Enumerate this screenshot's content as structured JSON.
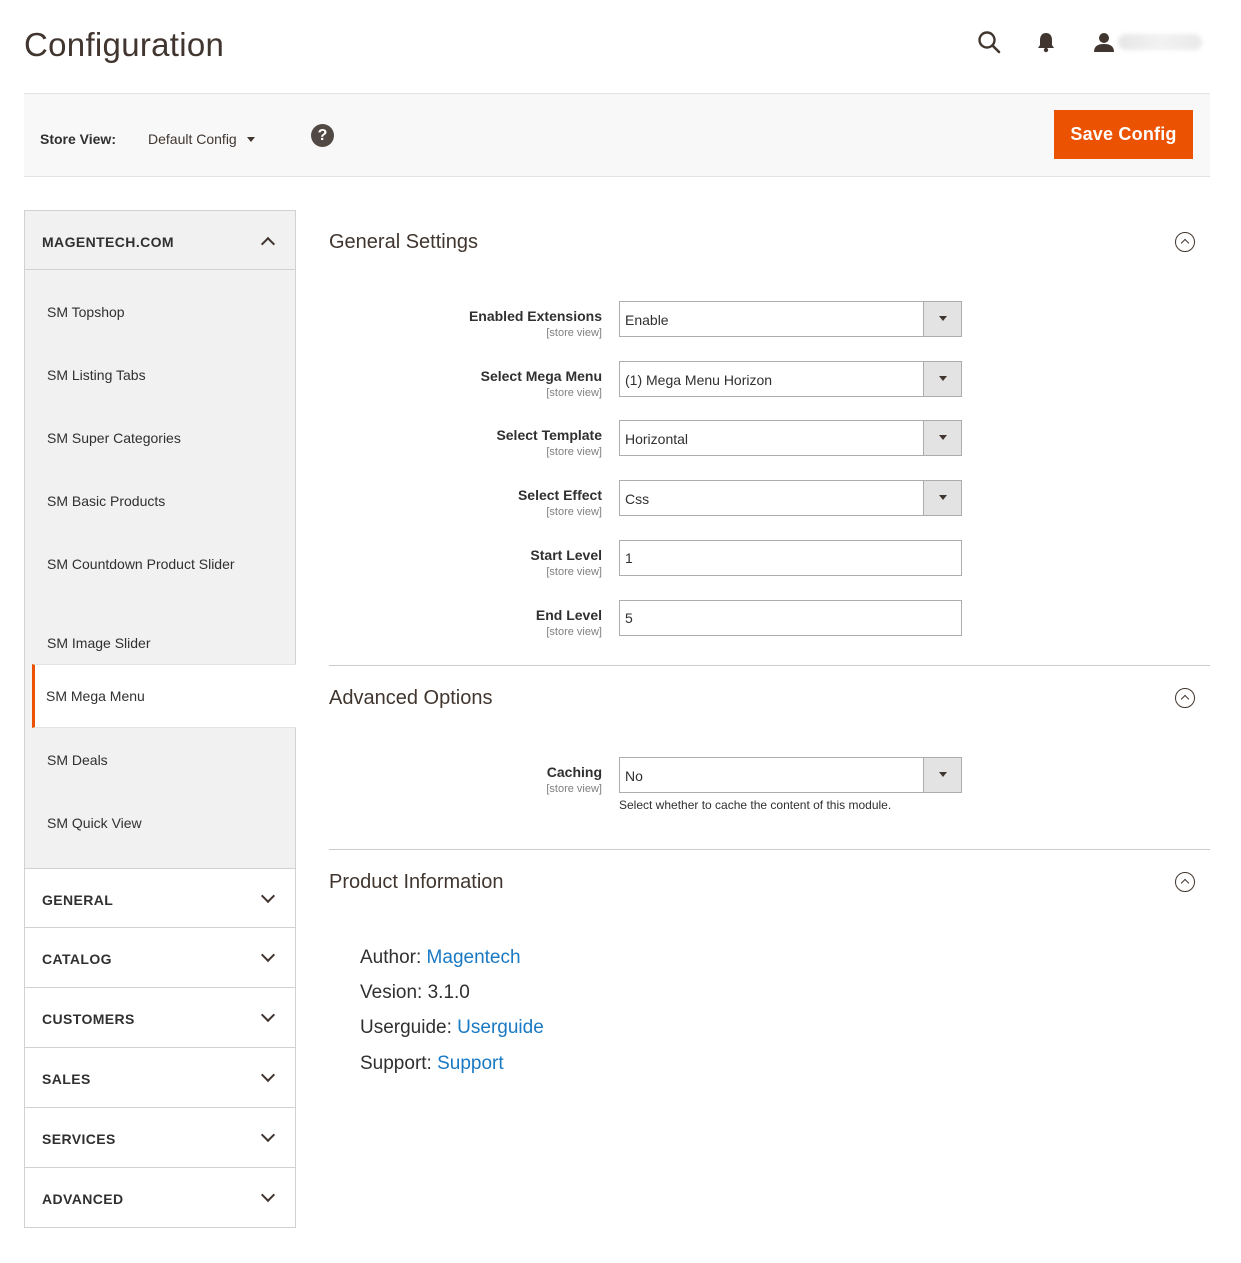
{
  "header": {
    "title": "Configuration"
  },
  "store_bar": {
    "label": "Store View:",
    "selected": "Default Config",
    "help": "?",
    "save_label": "Save Config"
  },
  "sidebar": {
    "open_tab": {
      "title": "MAGENTECH.COM",
      "items": [
        "SM Topshop",
        "SM Listing Tabs",
        "SM Super Categories",
        "SM Basic Products",
        "SM Countdown Product Slider",
        "SM Image Slider",
        "SM Mega Menu",
        "SM Deals",
        "SM Quick View"
      ],
      "active_index": 6
    },
    "tabs": [
      "GENERAL",
      "CATALOG",
      "CUSTOMERS",
      "SALES",
      "SERVICES",
      "ADVANCED"
    ]
  },
  "general": {
    "title": "General Settings",
    "fields": [
      {
        "label": "Enabled Extensions",
        "scope": "[store view]",
        "value": "Enable"
      },
      {
        "label": "Select Mega Menu",
        "scope": "[store view]",
        "value": "(1) Mega Menu Horizon"
      },
      {
        "label": "Select Template",
        "scope": "[store view]",
        "value": "Horizontal"
      },
      {
        "label": "Select Effect",
        "scope": "[store view]",
        "value": "Css"
      },
      {
        "label": "Start Level",
        "scope": "[store view]",
        "value": "1"
      },
      {
        "label": "End Level",
        "scope": "[store view]",
        "value": "5"
      }
    ]
  },
  "advanced": {
    "title": "Advanced Options",
    "caching": {
      "label": "Caching",
      "scope": "[store view]",
      "value": "No",
      "note": "Select whether to cache the content of this module."
    }
  },
  "product": {
    "title": "Product Information",
    "author_label": "Author:",
    "author_link": "Magentech",
    "version_text": "Vesion: 3.1.0",
    "guide_label": "Userguide:",
    "guide_link": "Userguide",
    "support_label": "Support:",
    "support_link": "Support"
  },
  "colors": {
    "accent": "#eb5202",
    "link": "#1979c3",
    "panel": "#f1f1f1"
  },
  "icons": {
    "search": "search-icon",
    "bell": "bell-icon",
    "user": "user-icon",
    "help": "help-icon",
    "collapse": "circle-chevron-up-icon"
  }
}
